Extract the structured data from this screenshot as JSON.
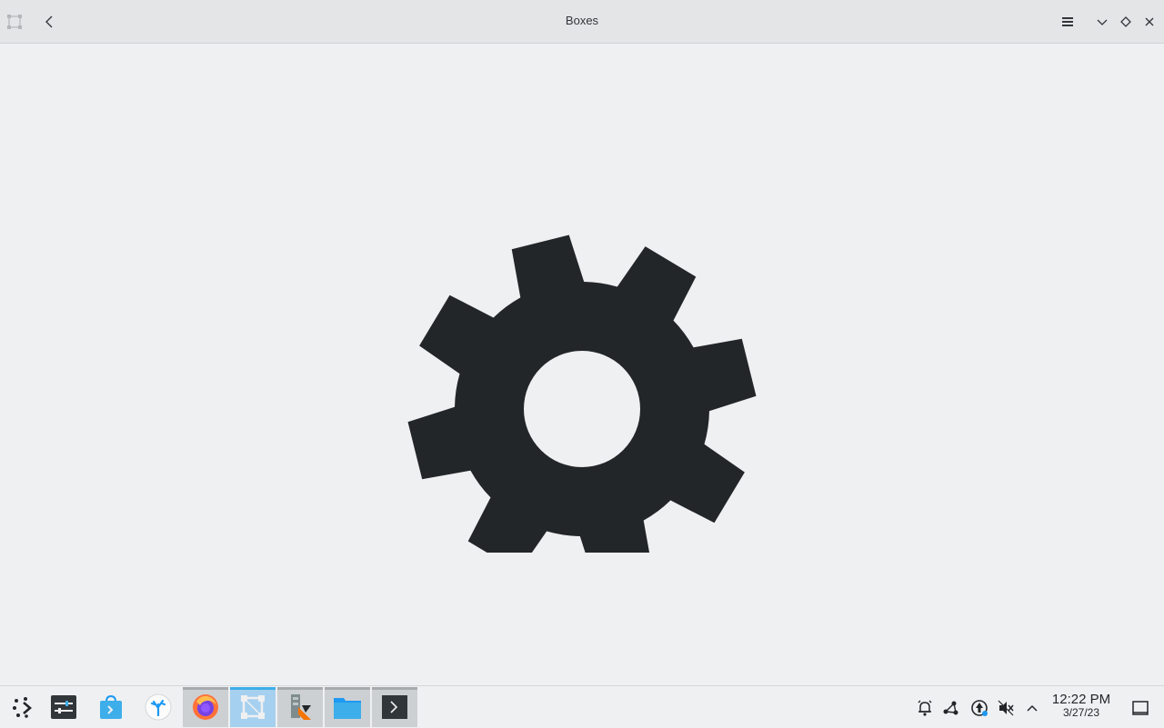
{
  "window": {
    "title": "Boxes",
    "app_icon": "boxes-app-icon",
    "back_icon": "back-arrow-icon",
    "menu_icon": "hamburger-menu-icon",
    "minimize_icon": "minimize-chevron-icon",
    "maximize_icon": "maximize-diamond-icon",
    "close_icon": "close-x-icon"
  },
  "content": {
    "center_icon": "gear-icon",
    "icon_color": "#232629",
    "background_color": "#eff0f1"
  },
  "taskbar": {
    "launcher_icon": "application-launcher-icon",
    "tasks": [
      {
        "name": "system-settings",
        "icon": "settings-sliders-icon",
        "state": "idle"
      },
      {
        "name": "discover",
        "icon": "store-bag-icon",
        "state": "idle"
      },
      {
        "name": "plasma-app",
        "icon": "coral-app-icon",
        "state": "idle"
      },
      {
        "name": "firefox",
        "icon": "firefox-icon",
        "state": "running"
      },
      {
        "name": "boxes",
        "icon": "boxes-icon",
        "state": "active"
      },
      {
        "name": "package-installer",
        "icon": "package-install-icon",
        "state": "running"
      },
      {
        "name": "dolphin",
        "icon": "folder-icon",
        "state": "running"
      },
      {
        "name": "konsole",
        "icon": "terminal-icon",
        "state": "running"
      }
    ],
    "tray": {
      "icons": [
        "notifications-icon",
        "network-icon",
        "updates-icon",
        "volume-muted-icon",
        "expand-tray-icon"
      ],
      "clock_time": "12:22 PM",
      "clock_date": "3/27/23",
      "show_desktop_icon": "show-desktop-icon"
    }
  },
  "accent_color": "#3daee9"
}
